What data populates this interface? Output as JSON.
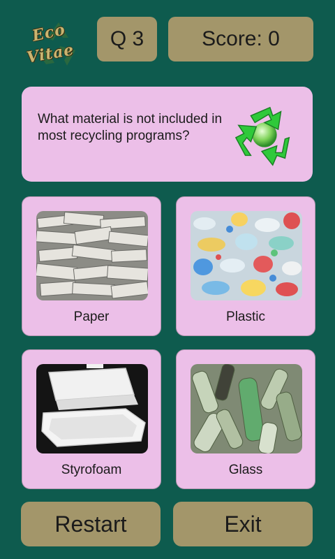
{
  "logo": {
    "line1": "Eco",
    "line2": "Vitae"
  },
  "header": {
    "question_number": "Q 3",
    "score": "Score: 0"
  },
  "question": {
    "text": "What material is not included in most recycling programs?",
    "icon": "recycle-icon"
  },
  "options": [
    {
      "label": "Paper",
      "image": "paper-stack-photo"
    },
    {
      "label": "Plastic",
      "image": "plastic-bottles-photo"
    },
    {
      "label": "Styrofoam",
      "image": "styrofoam-container-photo"
    },
    {
      "label": "Glass",
      "image": "glass-bottles-photo"
    }
  ],
  "buttons": {
    "restart": "Restart",
    "exit": "Exit"
  },
  "colors": {
    "background": "#0e5b4e",
    "card": "#ecbfe8",
    "button": "#a3966a",
    "text": "#1b1b1b"
  }
}
